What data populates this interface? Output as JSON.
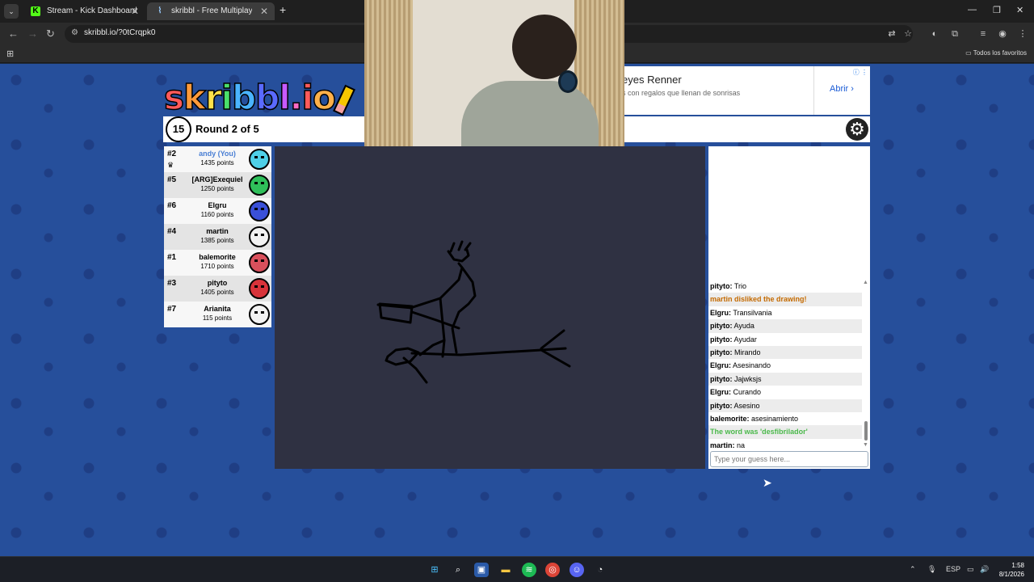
{
  "browser": {
    "tabs": [
      {
        "title": "Stream - Kick Dashboard",
        "favicon": "K"
      },
      {
        "title": "skribbl - Free Multiplayer Draw",
        "favicon": "⌇"
      }
    ],
    "url": "skribbl.io/?0tCrqpk0",
    "bookmarks_all": "Todos los favoritos"
  },
  "ad": {
    "title": "eyes Renner",
    "subtitle": "s con regalos que llenan de sonrisas",
    "open_label": "Abrir ›",
    "info": "ⓘ ⋮"
  },
  "game": {
    "logo": "skribbl.io",
    "timer": "15",
    "round": "Round 2 of 5",
    "players": [
      {
        "rank": "#2",
        "name": "andy (You)",
        "points": "1435 points",
        "you": true,
        "color": "#4fd0e8"
      },
      {
        "rank": "#5",
        "name": "[ARG]Exequiel",
        "points": "1250 points",
        "you": false,
        "color": "#2fbf5a"
      },
      {
        "rank": "#6",
        "name": "Elgru",
        "points": "1160 points",
        "you": false,
        "color": "#3a50d8"
      },
      {
        "rank": "#4",
        "name": "martin",
        "points": "1385 points",
        "you": false,
        "color": "#f2f2f2"
      },
      {
        "rank": "#1",
        "name": "balemorite",
        "points": "1710 points",
        "you": false,
        "color": "#d9505c"
      },
      {
        "rank": "#3",
        "name": "pityto",
        "points": "1405 points",
        "you": false,
        "color": "#d8333a"
      },
      {
        "rank": "#7",
        "name": "Arianita",
        "points": "115 points",
        "you": false,
        "color": "#f2f2f2"
      }
    ]
  },
  "chat": {
    "messages": [
      {
        "author": "pityto:",
        "text": "Trio",
        "type": "normal"
      },
      {
        "author": "",
        "text": "martin disliked the drawing!",
        "type": "orange"
      },
      {
        "author": "Elgru:",
        "text": "Transilvania",
        "type": "normal"
      },
      {
        "author": "pityto:",
        "text": "Ayuda",
        "type": "normal"
      },
      {
        "author": "pityto:",
        "text": "Ayudar",
        "type": "normal"
      },
      {
        "author": "pityto:",
        "text": "Mirando",
        "type": "normal"
      },
      {
        "author": "Elgru:",
        "text": "Asesinando",
        "type": "normal"
      },
      {
        "author": "pityto:",
        "text": "Jajwksjs",
        "type": "normal"
      },
      {
        "author": "Elgru:",
        "text": "Curando",
        "type": "normal"
      },
      {
        "author": "pityto:",
        "text": "Asesino",
        "type": "normal"
      },
      {
        "author": "balemorite:",
        "text": "asesinamiento",
        "type": "normal"
      },
      {
        "author": "",
        "text": "The word was 'desfibrilador'",
        "type": "green"
      },
      {
        "author": "martin:",
        "text": "na",
        "type": "normal"
      }
    ],
    "placeholder": "Type your guess here..."
  },
  "taskbar": {
    "lang": "ESP",
    "time": "1:58",
    "date": "8/1/2026"
  }
}
